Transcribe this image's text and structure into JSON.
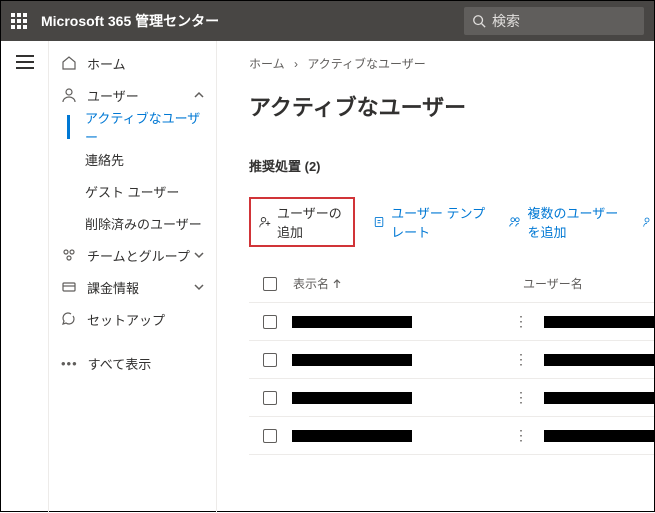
{
  "header": {
    "app_title": "Microsoft 365 管理センター",
    "search_placeholder": "検索"
  },
  "sidebar": {
    "home": "ホーム",
    "users": "ユーザー",
    "users_children": {
      "active": "アクティブなユーザー",
      "contacts": "連絡先",
      "guest": "ゲスト ユーザー",
      "deleted": "削除済みのユーザー"
    },
    "teams": "チームとグループ",
    "billing": "課金情報",
    "setup": "セットアップ",
    "show_all": "すべて表示"
  },
  "breadcrumb": {
    "home": "ホーム",
    "current": "アクティブなユーザー"
  },
  "page": {
    "title": "アクティブなユーザー",
    "recommended": "推奨処置 (2)"
  },
  "toolbar": {
    "add_user": "ユーザーの追加",
    "templates": "ユーザー テンプレート",
    "add_multiple": "複数のユーザーを追加"
  },
  "table": {
    "col_display_name": "表示名",
    "col_username": "ユーザー名",
    "rows": [
      {
        "display_name": "█████",
        "username": "█████"
      },
      {
        "display_name": "█████",
        "username": "█████"
      },
      {
        "display_name": "█████",
        "username": "█████"
      },
      {
        "display_name": "█████",
        "username": "█████"
      }
    ]
  }
}
